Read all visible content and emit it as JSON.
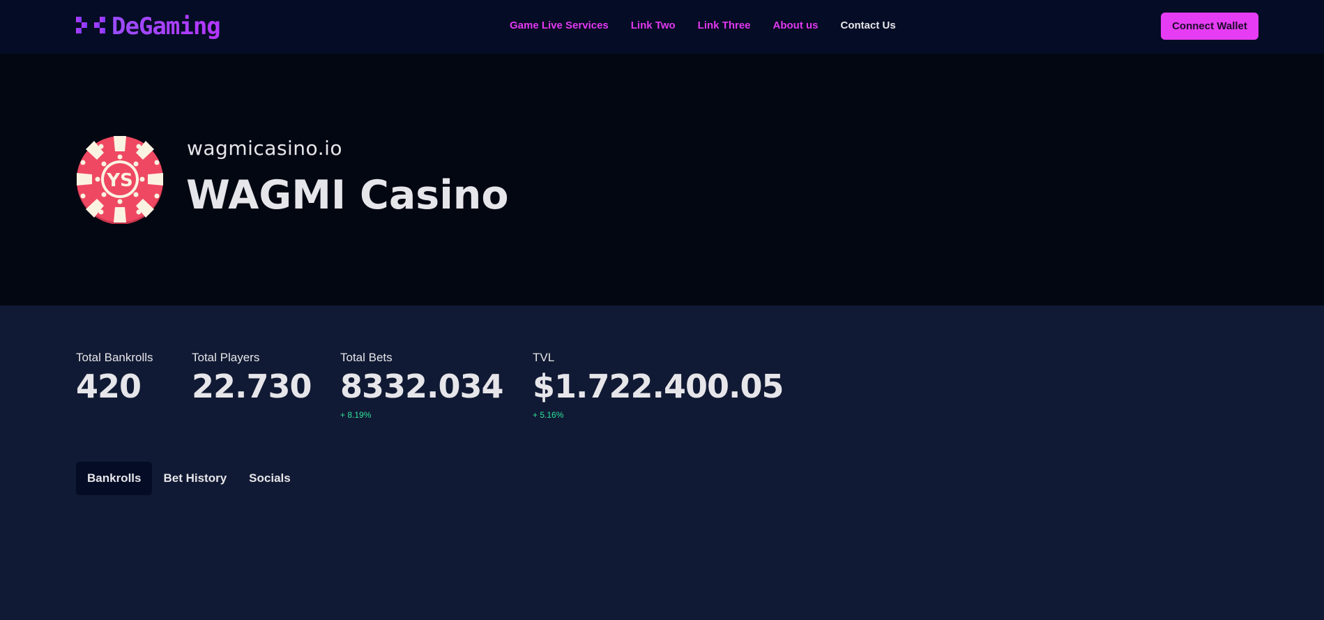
{
  "brand": {
    "name": "DeGaming",
    "accent": "#a447ff"
  },
  "nav": {
    "links": [
      {
        "label": "Game Live Services"
      },
      {
        "label": "Link Two"
      },
      {
        "label": "Link Three"
      },
      {
        "label": "About us"
      },
      {
        "label": "Contact Us"
      }
    ],
    "connect_label": "Connect Wallet",
    "link_color": "#e239f0",
    "button_color": "#e63cf3"
  },
  "casino": {
    "domain": "wagmicasino.io",
    "name": "WAGMI Casino",
    "logo_text": "YS",
    "logo_color": "#e8455e"
  },
  "stats": [
    {
      "label": "Total Bankrolls",
      "value": "420",
      "change": ""
    },
    {
      "label": "Total Players",
      "value": "22.730",
      "change": ""
    },
    {
      "label": "Total Bets",
      "value": "8332.034",
      "change": "+ 8.19%"
    },
    {
      "label": "TVL",
      "value": "$1.722.400.05",
      "change": "+ 5.16%"
    }
  ],
  "tabs": [
    {
      "label": "Bankrolls",
      "active": true
    },
    {
      "label": "Bet History",
      "active": false
    },
    {
      "label": "Socials",
      "active": false
    }
  ],
  "colors": {
    "positive": "#2ee59d",
    "background": "#111a34",
    "hero": "#030712"
  }
}
